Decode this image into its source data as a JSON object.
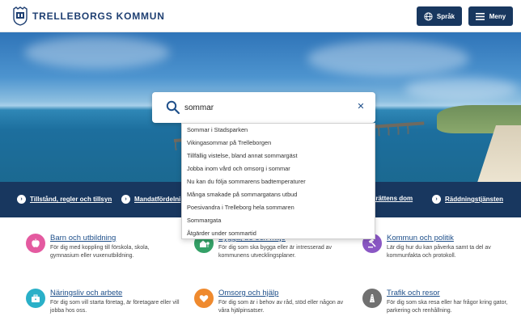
{
  "header": {
    "logo_text": "TRELLEBORGS KOMMUN",
    "language_label": "Språk",
    "menu_label": "Meny"
  },
  "search": {
    "value": "sommar",
    "suggestions": [
      "Sommar i Stadsparken",
      "Vikingasommar på Trelleborgen",
      "Tillfällig vistelse, bland annat sommargäst",
      "Jobba inom vård och omsorg i sommar",
      "Nu kan du följa sommarens badtemperaturer",
      "Många smakade på sommargatans utbud",
      "Poesivandra i Trelleborg hela sommaren",
      "Sommargata",
      "Åtgärder under sommartid"
    ]
  },
  "quick_links": [
    "Tillstånd, regler och tillsyn",
    "Mandatfördelni",
    "gsrättens dom",
    "Räddningstjänsten"
  ],
  "categories": [
    {
      "title": "Barn och utbildning",
      "desc": "För dig med koppling till förskola, skola, gymnasium eller vuxenutbildning.",
      "icon": "apple-icon",
      "color": "#e45aa0"
    },
    {
      "title": "Bygga, bo och miljö",
      "desc": "För dig som ska bygga eller är intresserad av kommunens utvecklingsplaner.",
      "icon": "house-tree-icon",
      "color": "#34a067"
    },
    {
      "title": "Kommun och politik",
      "desc": "Lär dig hur du kan påverka samt ta del av kommunfakta och protokoll.",
      "icon": "gavel-icon",
      "color": "#8a57c4"
    },
    {
      "title": "Näringsliv och arbete",
      "desc": "För dig som vill starta företag, är företagare eller vill jobba hos oss.",
      "icon": "briefcase-icon",
      "color": "#2ab0c8"
    },
    {
      "title": "Omsorg och hjälp",
      "desc": "För dig som är i behov av råd, stöd eller någon av våra hjälpinsatser.",
      "icon": "heart-icon",
      "color": "#ef8a2e"
    },
    {
      "title": "Trafik och resor",
      "desc": "För dig som ska resa eller har frågor kring gator, parkering och renhållning.",
      "icon": "road-icon",
      "color": "#707070"
    }
  ]
}
